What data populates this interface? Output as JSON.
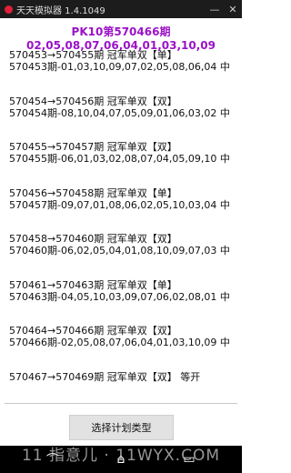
{
  "window": {
    "title": "天天模拟器 1.4.1049",
    "min_symbol": "—",
    "close_symbol": "✕"
  },
  "header": {
    "text": "PK10第570466期  02,05,08,07,06,04,01,03,10,09"
  },
  "entries": [
    {
      "line1": "570453→570455期  冠军单双【单】",
      "line2": "570453期-01,03,10,09,07,02,05,08,06,04 中"
    },
    {
      "line1": "570454→570456期  冠军单双【双】",
      "line2": "570454期-08,10,04,07,05,09,01,06,03,02 中"
    },
    {
      "line1": "570455→570457期  冠军单双【双】",
      "line2": "570455期-06,01,03,02,08,07,04,05,09,10 中"
    },
    {
      "line1": "570456→570458期  冠军单双【单】",
      "line2": "570457期-09,07,01,08,06,02,05,10,03,04 中"
    },
    {
      "line1": "570458→570460期  冠军单双【双】",
      "line2": "570460期-06,02,05,04,01,08,10,09,07,03 中"
    },
    {
      "line1": "570461→570463期  冠军单双【单】",
      "line2": "570463期-04,05,10,03,09,07,06,02,08,01 中"
    },
    {
      "line1": "570464→570466期  冠军单双【双】",
      "line2": "570466期-02,05,08,07,06,04,01,03,10,09 中"
    },
    {
      "line1": "570467→570469期  冠军单双【双】 等开",
      "line2": ""
    }
  ],
  "buttons": {
    "select_plan": "选择计划类型"
  },
  "watermark": {
    "text": "11 指意儿 · 11WYX.COM"
  },
  "nav": {
    "back": "⌒",
    "home": "⌂",
    "recent": "▭"
  },
  "colors": {
    "header": "#9b12c7",
    "titlebar": "#1c1c1c",
    "navbar": "#000000"
  }
}
